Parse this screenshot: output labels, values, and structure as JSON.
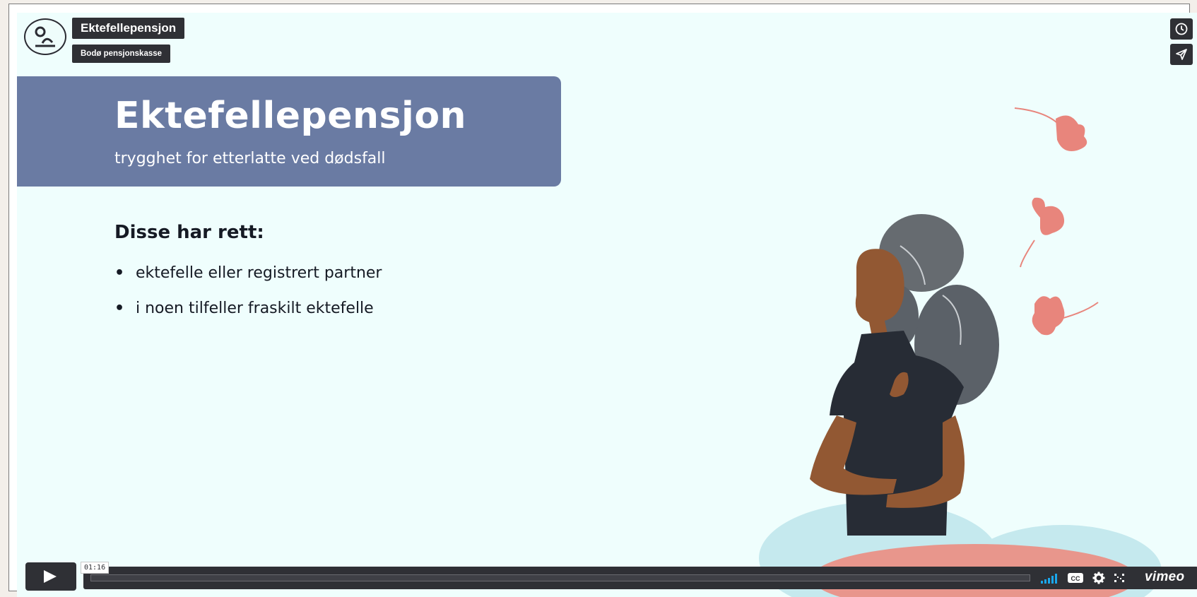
{
  "header": {
    "video_title": "Ektefellepensjon",
    "owner": "Bodø pensjonskasse",
    "avatar_icon": "person-logo-icon"
  },
  "side_buttons": [
    {
      "icon": "clock-icon"
    },
    {
      "icon": "paper-plane-icon"
    }
  ],
  "slide": {
    "title": "Ektefellepensjon",
    "subtitle": "trygghet for etterlatte ved dødsfall",
    "rights_heading": "Disse har rett:",
    "rights": [
      "ektefelle eller registrert partner",
      "i noen tilfeller fraskilt ektefelle"
    ]
  },
  "player": {
    "current_time": "01:16",
    "progress": 0.0,
    "brand": "vimeo",
    "controls": [
      "volume-icon",
      "cc-icon",
      "settings-icon",
      "fullscreen-icon"
    ]
  },
  "colors": {
    "banner": "#6a7ba3",
    "background": "#effefd",
    "control_bar": "#2f3035",
    "accent_leaf": "#e8857c",
    "volume": "#1aa7ec"
  }
}
